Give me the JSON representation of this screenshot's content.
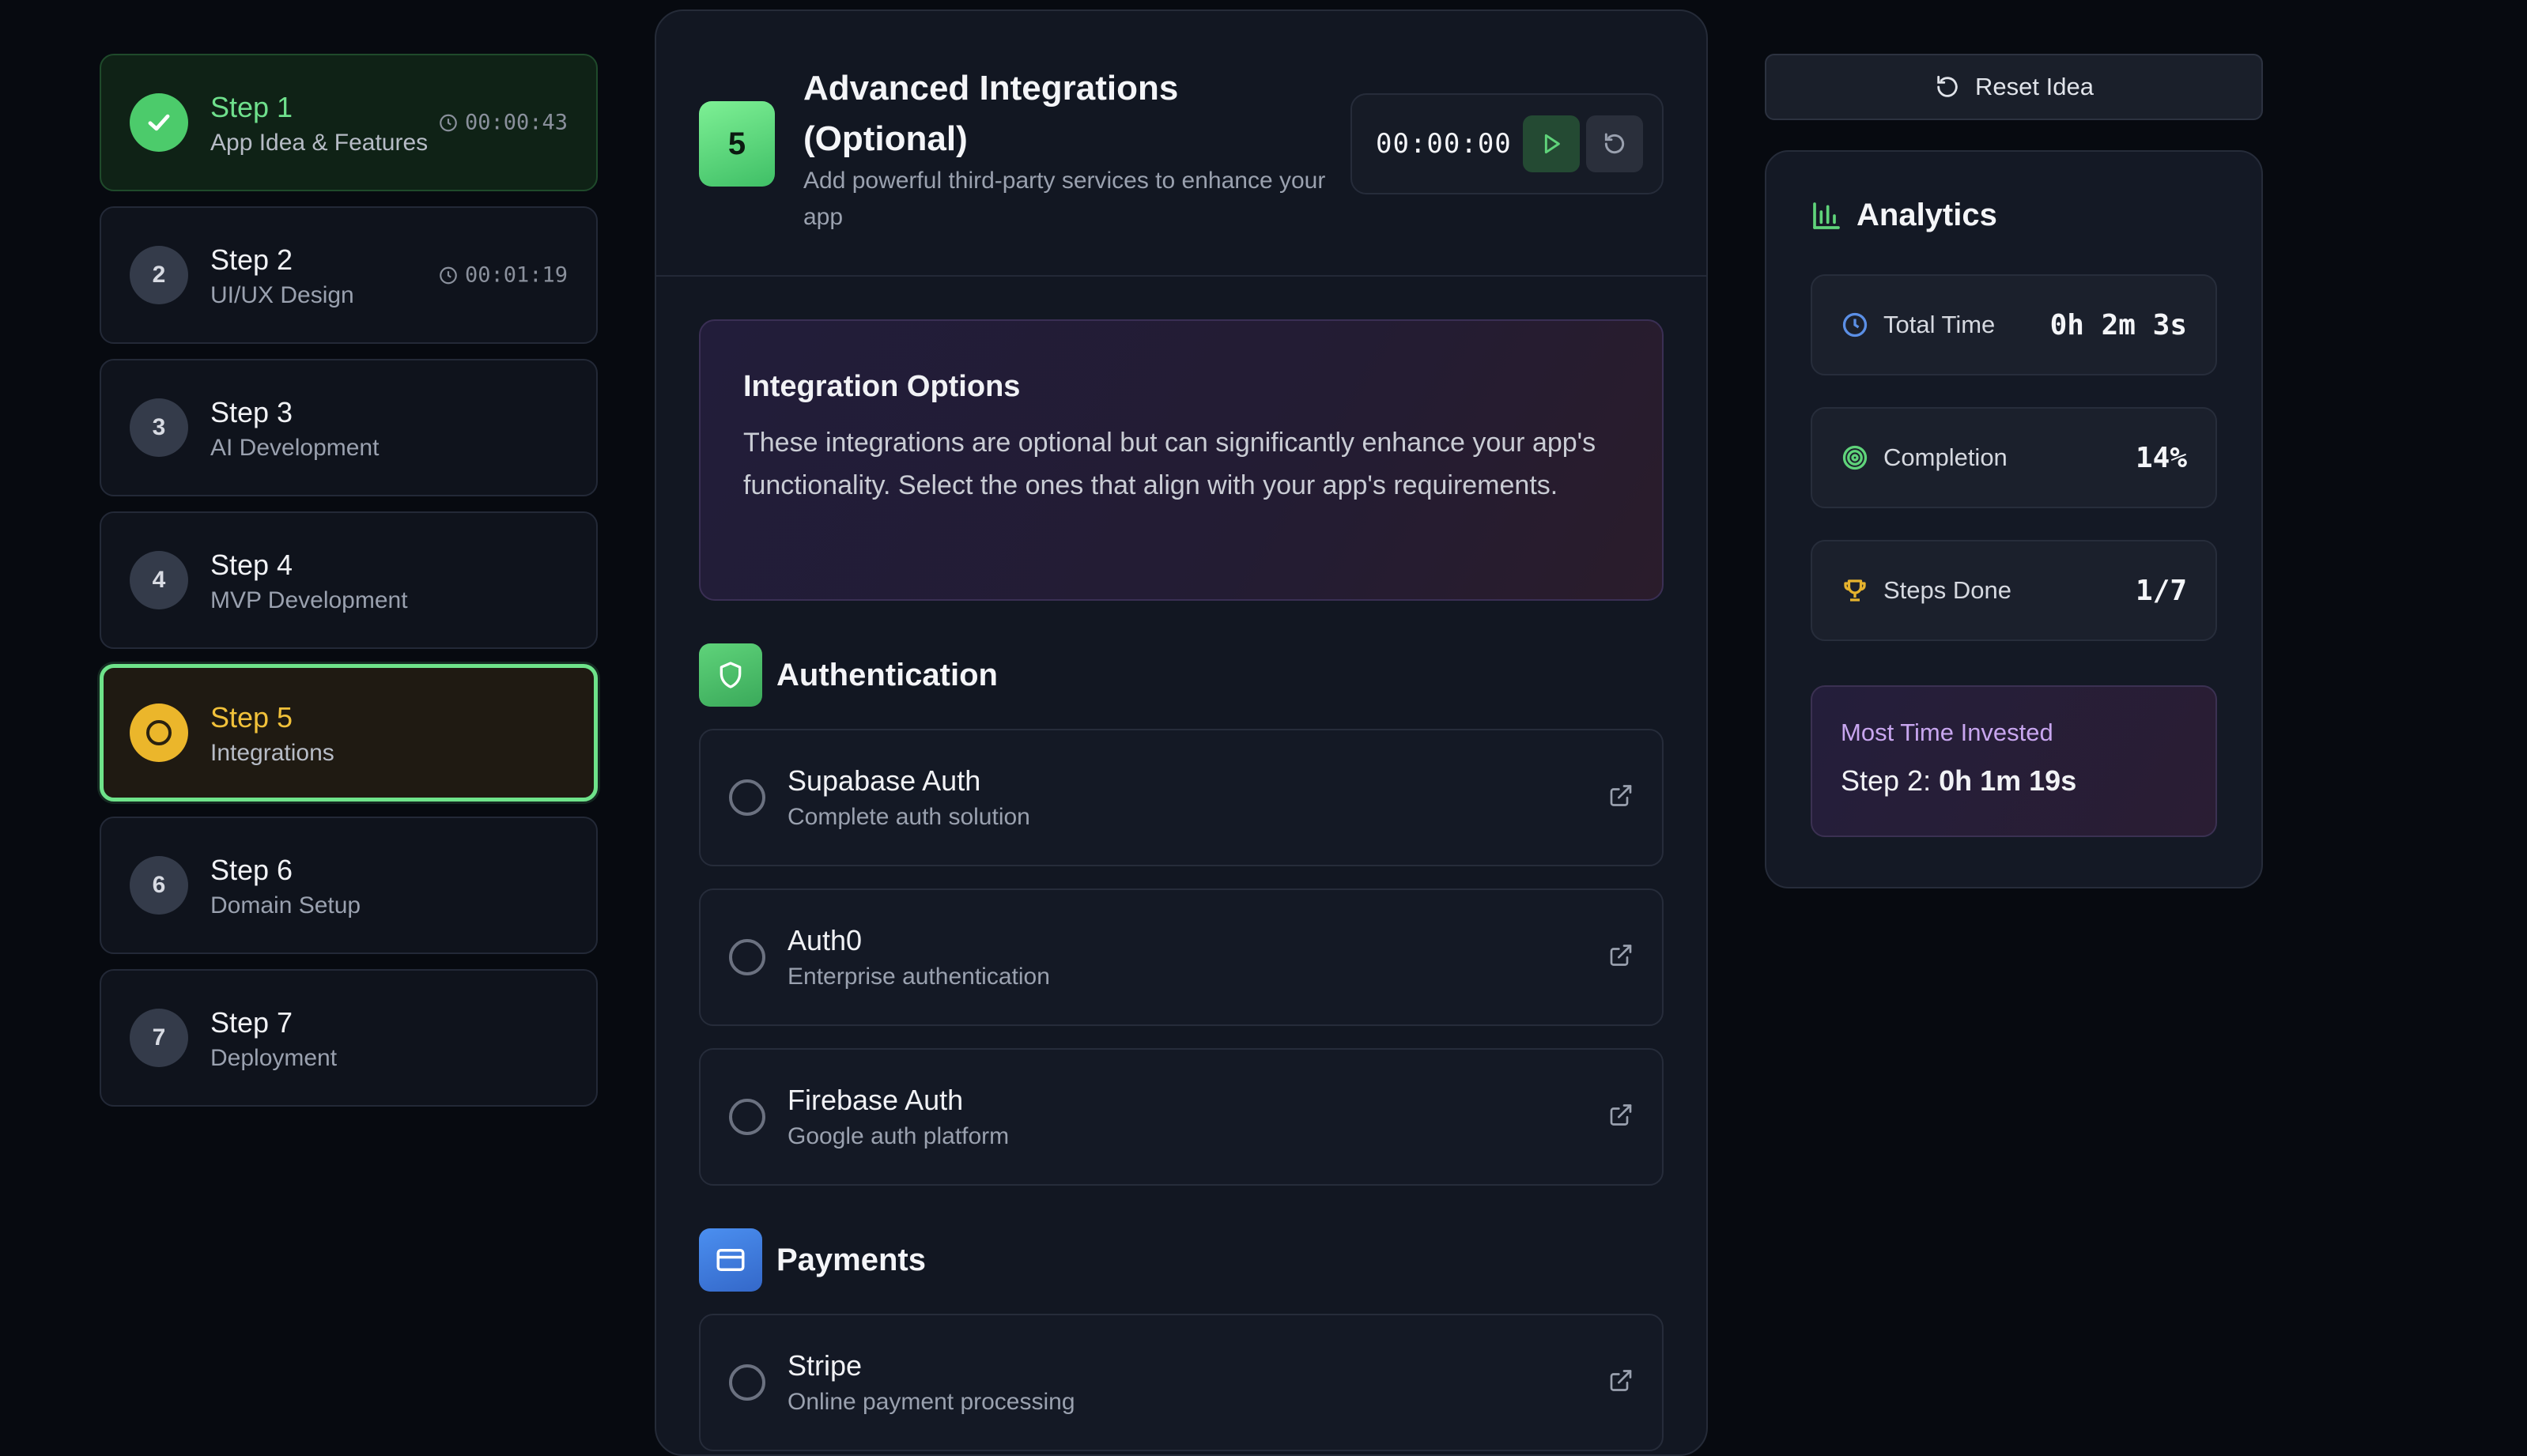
{
  "steps": [
    {
      "title": "Step 1",
      "subtitle": "App Idea & Features",
      "timer": "00:00:43",
      "number": "",
      "state": "done"
    },
    {
      "title": "Step 2",
      "subtitle": "UI/UX Design",
      "timer": "00:01:19",
      "number": "2",
      "state": "default"
    },
    {
      "title": "Step 3",
      "subtitle": "AI Development",
      "number": "3",
      "state": "default"
    },
    {
      "title": "Step 4",
      "subtitle": "MVP Development",
      "number": "4",
      "state": "default"
    },
    {
      "title": "Step 5",
      "subtitle": "Integrations",
      "number": "",
      "state": "active"
    },
    {
      "title": "Step 6",
      "subtitle": "Domain Setup",
      "number": "6",
      "state": "default"
    },
    {
      "title": "Step 7",
      "subtitle": "Deployment",
      "number": "7",
      "state": "default"
    }
  ],
  "main": {
    "step_number": "5",
    "title": "Advanced Integrations (Optional)",
    "description": "Add powerful third-party services to enhance your app",
    "timer": "00:00:00",
    "info": {
      "title": "Integration Options",
      "text": "These integrations are optional but can significantly enhance your app's functionality. Select the ones that align with your app's requirements."
    },
    "sections": [
      {
        "title": "Authentication",
        "icon": "shield-icon",
        "options": [
          {
            "title": "Supabase Auth",
            "subtitle": "Complete auth solution"
          },
          {
            "title": "Auth0",
            "subtitle": "Enterprise authentication"
          },
          {
            "title": "Firebase Auth",
            "subtitle": "Google auth platform"
          }
        ]
      },
      {
        "title": "Payments",
        "icon": "credit-card-icon",
        "options": [
          {
            "title": "Stripe",
            "subtitle": "Online payment processing"
          }
        ]
      }
    ]
  },
  "sidebar_right": {
    "reset_label": "Reset Idea",
    "analytics_title": "Analytics",
    "stats": [
      {
        "label": "Total Time",
        "value": "0h 2m 3s",
        "icon": "clock-icon"
      },
      {
        "label": "Completion",
        "value": "14%",
        "icon": "target-icon"
      },
      {
        "label": "Steps Done",
        "value": "1/7",
        "icon": "trophy-icon"
      }
    ],
    "most_time": {
      "label": "Most Time Invested",
      "step": "Step 2:",
      "value": "0h 1m 19s"
    }
  },
  "colors": {
    "accent_green": "#4ccb6b",
    "active_yellow": "#ebb62b",
    "background": "#070a10"
  }
}
